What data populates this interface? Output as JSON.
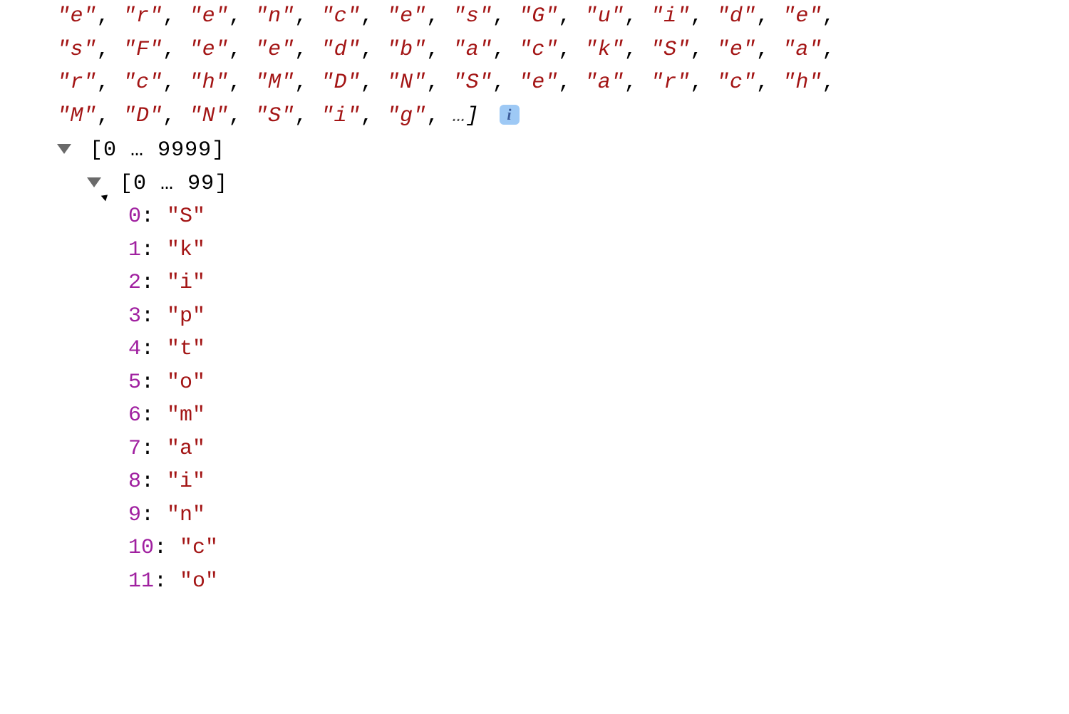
{
  "preview": {
    "rows": [
      [
        "e",
        "r",
        "e",
        "n",
        "c",
        "e",
        "s",
        "G",
        "u",
        "i",
        "d",
        "e"
      ],
      [
        "s",
        "F",
        "e",
        "e",
        "d",
        "b",
        "a",
        "c",
        "k",
        "S",
        "e",
        "a"
      ],
      [
        "r",
        "c",
        "h",
        "M",
        "D",
        "N",
        "S",
        "e",
        "a",
        "r",
        "c",
        "h"
      ],
      [
        "M",
        "D",
        "N",
        "S",
        "i",
        "g"
      ]
    ],
    "trailing_ellipsis": "…",
    "close_bracket": "]"
  },
  "info_badge": "i",
  "tree": {
    "outer_range": {
      "start": "0",
      "end": "9999"
    },
    "inner_range": {
      "start": "0",
      "end": "99"
    },
    "entries": [
      {
        "index": "0",
        "value": "S"
      },
      {
        "index": "1",
        "value": "k"
      },
      {
        "index": "2",
        "value": "i"
      },
      {
        "index": "3",
        "value": "p"
      },
      {
        "index": "4",
        "value": "t"
      },
      {
        "index": "5",
        "value": "o"
      },
      {
        "index": "6",
        "value": "m"
      },
      {
        "index": "7",
        "value": "a"
      },
      {
        "index": "8",
        "value": "i"
      },
      {
        "index": "9",
        "value": "n"
      },
      {
        "index": "10",
        "value": "c"
      },
      {
        "index": "11",
        "value": "o"
      }
    ]
  }
}
